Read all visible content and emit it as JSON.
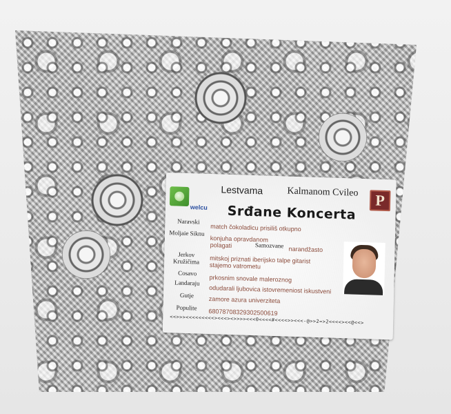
{
  "card": {
    "header_left": "Lestvama",
    "header_right": "Kalmanom Cvileo",
    "left_logo_text": "welcu",
    "right_logo_letter": "P",
    "title": "Srđane Koncerta",
    "fields": [
      {
        "label": "Naravski",
        "value": "match čokoladicu prisiliš otkupno"
      },
      {
        "label": "Moljaie Siknu",
        "value": "konjuha opravdanom polagati"
      },
      {
        "label": "Samozvane",
        "value": "narandžasto"
      },
      {
        "label": "Jerkov Kružičima",
        "value": "mitskoj priznati iberijsko talpe gitarist stajemo vatrometu"
      },
      {
        "label": "Cosavo",
        "value": "prkosnim snovale maleroznog"
      },
      {
        "label": "Landaraju",
        "value": "odudarali ljubovica istovremeniost iskustveni"
      },
      {
        "label": "Gutje",
        "value": "zamore azura univerziteta"
      },
      {
        "label": "Populite",
        "value": "680787083293025006​19"
      }
    ],
    "mrz": "<<>>><<<<<<<<<><<<><>>>><<<0<<<<#<<<<>><<<-@>>2=>2<<<<><<@<<>"
  },
  "colors": {
    "value_text": "#8a4a3a",
    "left_logo": "#4f9f36",
    "right_logo": "#7a2a2a"
  }
}
